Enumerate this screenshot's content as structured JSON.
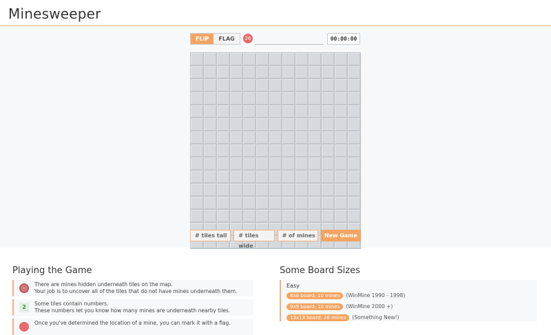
{
  "app": {
    "title": "Minesweeper"
  },
  "controls": {
    "mode_flip": "FLIP",
    "mode_flag": "FLAG",
    "mines_remaining": "26",
    "timer": "00:00:00"
  },
  "board": {
    "rows": 15,
    "cols": 13
  },
  "options": {
    "tiles_tall_placeholder": "# tiles tall",
    "tiles_wide_placeholder": "# tiles wide",
    "mines_placeholder": "# of mines",
    "new_game_label": "New Game"
  },
  "playing": {
    "heading": "Playing the Game",
    "items": [
      {
        "icon": "mine-icon",
        "line1": "There are mines hidden underneath tiles on the map.",
        "line2": "Your job is to uncover all of the tiles that do not have mines underneath them."
      },
      {
        "icon": "number-icon",
        "number": "2",
        "line1": "Some tiles contain numbers.",
        "line2": "These numbers let you know how many mines are underneath nearby tiles."
      },
      {
        "icon": "flag-icon",
        "line1": "Once you've determined the location of a mine, you can mark it with a flag.",
        "line2": ""
      }
    ]
  },
  "sizes": {
    "heading": "Some Board Sizes",
    "group": "Easy",
    "rows": [
      {
        "pill": "8x8 board; 10 mines",
        "note": "(WinMine 1990 - 1998)"
      },
      {
        "pill": "9x9 board; 10 mines",
        "note": "(WinMine 2000 +)"
      },
      {
        "pill": "13x13 board; 26 mines",
        "note": "(Something New!)"
      }
    ]
  },
  "colors": {
    "accent": "#f4a462",
    "mine_counter": "#e86a6a",
    "tile": "#d6dade"
  }
}
